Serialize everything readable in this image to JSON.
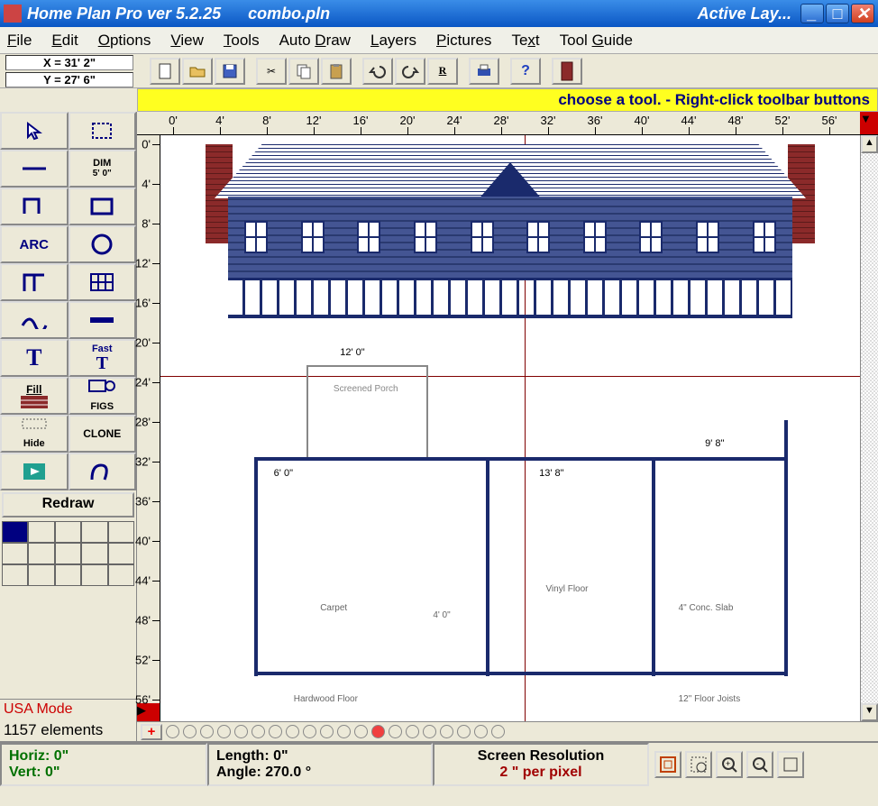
{
  "titlebar": {
    "app_title": "Home Plan Pro ver 5.2.25",
    "filename": "combo.pln",
    "layer_label": "Active Lay..."
  },
  "menubar": {
    "items": [
      "File",
      "Edit",
      "Options",
      "View",
      "Tools",
      "Auto Draw",
      "Layers",
      "Pictures",
      "Text",
      "Tool Guide"
    ]
  },
  "coords": {
    "x": "X = 31' 2\"",
    "y": "Y = 27' 6\""
  },
  "hint": "choose a tool.  -  Right-click toolbar buttons",
  "ruler_h": [
    "0'",
    "4'",
    "8'",
    "12'",
    "16'",
    "20'",
    "24'",
    "28'",
    "32'",
    "36'",
    "40'",
    "44'",
    "48'",
    "52'",
    "56'"
  ],
  "ruler_v": [
    "0'",
    "4'",
    "8'",
    "12'",
    "16'",
    "20'",
    "24'",
    "28'",
    "32'",
    "36'",
    "40'",
    "44'",
    "48'",
    "52'",
    "56'"
  ],
  "tools": {
    "dim_label": "DIM",
    "dim_sub": "5' 0\"",
    "arc_label": "ARC",
    "fast_label": "Fast",
    "fill_label": "Fill",
    "figs_label": "FIGS",
    "hide_label": "Hide",
    "clone_label": "CLONE",
    "redraw_label": "Redraw"
  },
  "palette_colors": [
    "#000080",
    "#ffffff",
    "#ffffff",
    "#ffffff",
    "#ffffff",
    "#ffffff",
    "#ffffff",
    "#ffffff",
    "#ffffff",
    "#ffffff",
    "#ffffff",
    "#ffffff",
    "#ffffff",
    "#ffffff",
    "#ffffff"
  ],
  "mode_label": "USA Mode",
  "element_count": "1157 elements",
  "plan_labels": {
    "porch": "Screened Porch",
    "dim_12_0": "12' 0\"",
    "dim_6_0": "6' 0\"",
    "dim_13_8": "13' 8\"",
    "dim_9_8": "9' 8\"",
    "dim_4_0": "4' 0\"",
    "carpet": "Carpet",
    "vinyl": "Vinyl Floor",
    "conc": "4\" Conc. Slab",
    "hardwood": "Hardwood Floor",
    "joists": "12\" Floor Joists"
  },
  "status": {
    "horiz": "Horiz:  0\"",
    "vert": "Vert:   0\"",
    "length": "Length:  0\"",
    "angle": "Angle: 270.0 °",
    "res_label": "Screen Resolution",
    "res_value": "2 \" per pixel"
  }
}
